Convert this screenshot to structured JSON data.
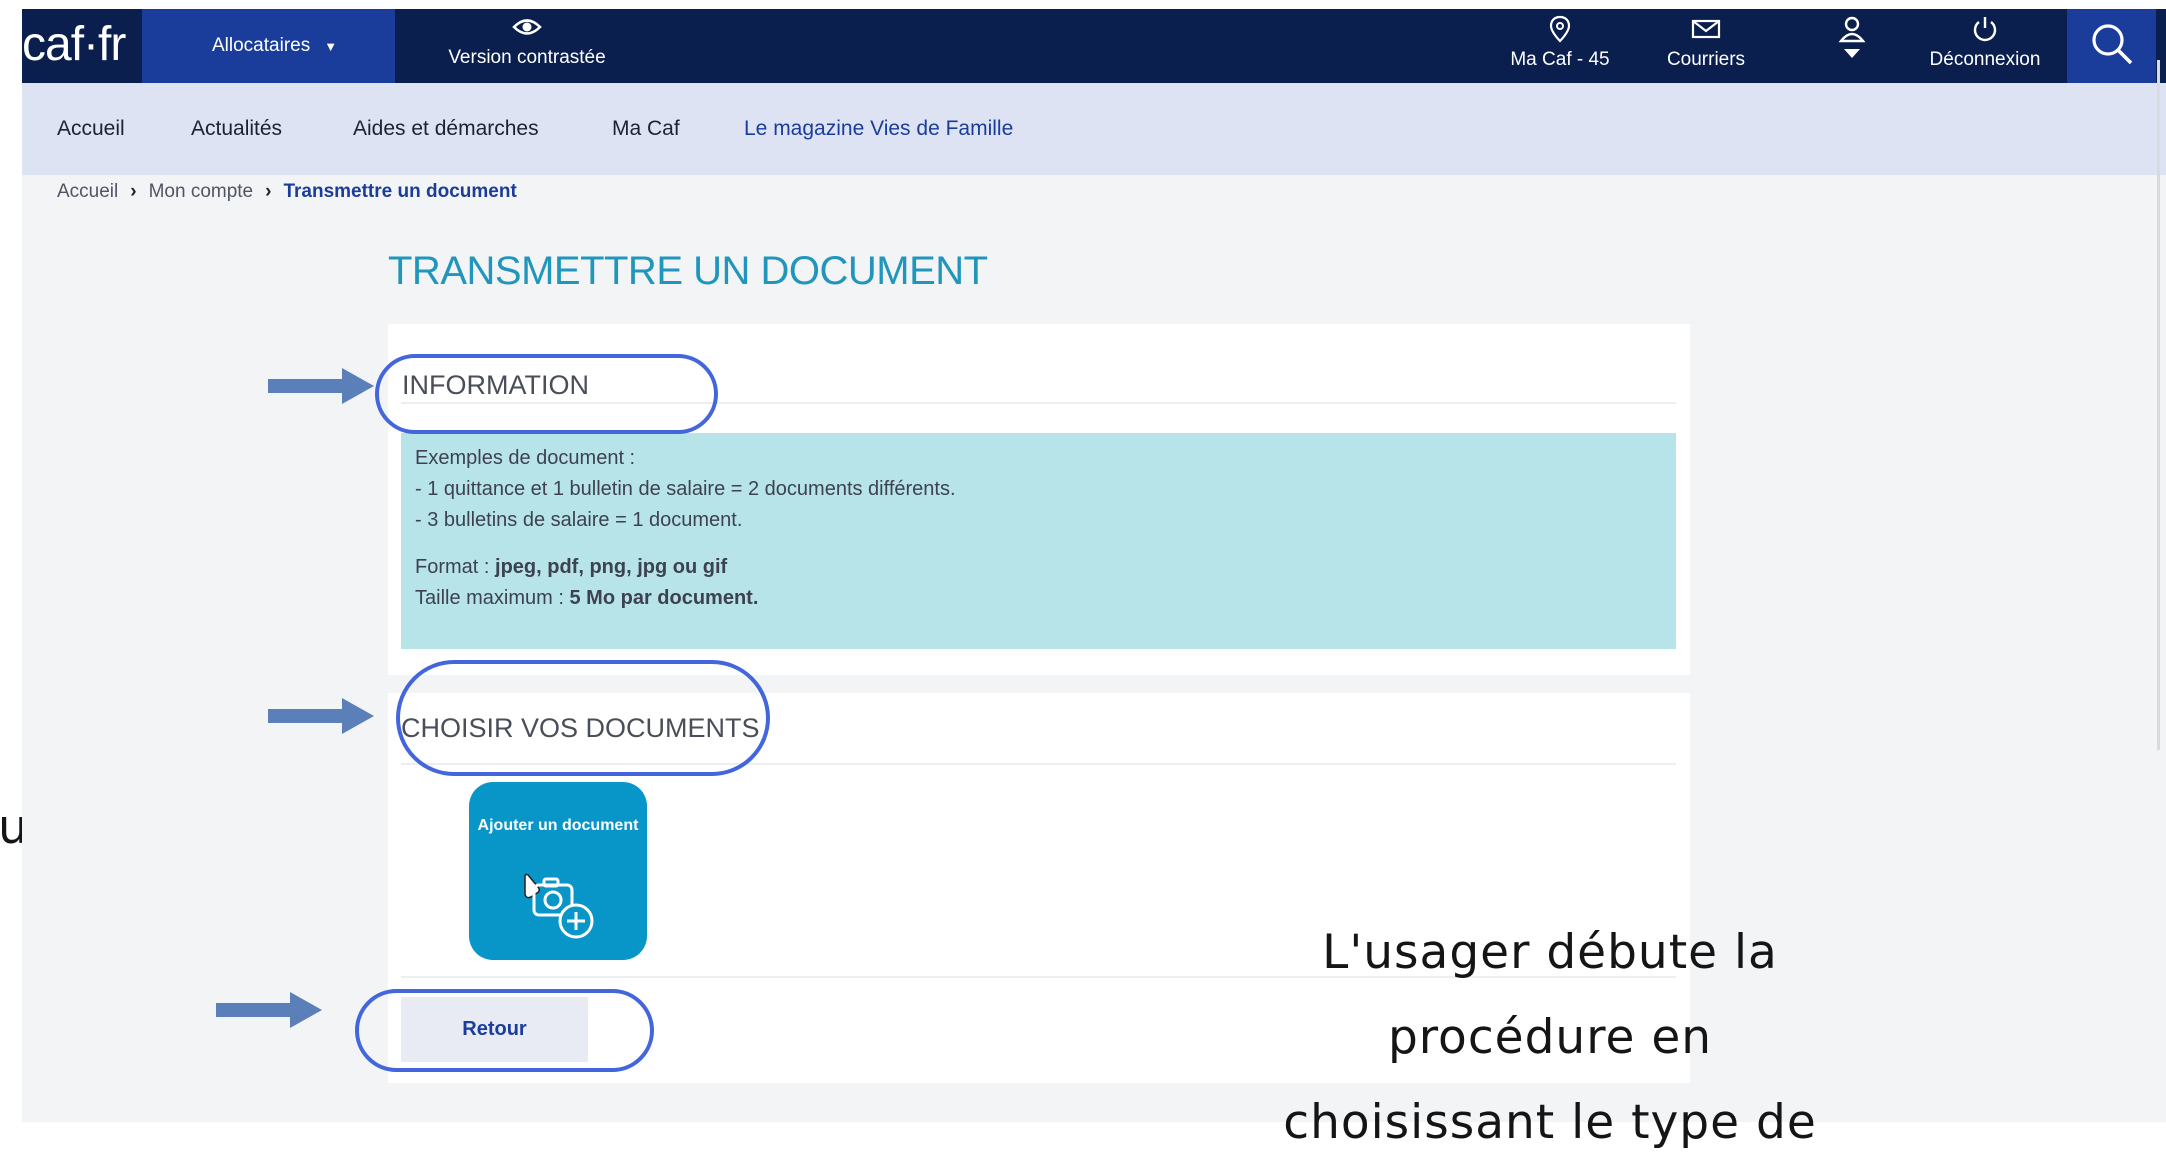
{
  "topbar": {
    "logo": "caf·fr",
    "audience": "Allocataires",
    "contrast": "Version contrastée",
    "macaf": "Ma Caf - 45",
    "courriers": "Courriers",
    "logout": "Déconnexion"
  },
  "nav": [
    "Accueil",
    "Actualités",
    "Aides et démarches",
    "Ma Caf",
    "Le magazine Vies de Famille"
  ],
  "breadcrumb": [
    "Accueil",
    "Mon compte",
    "Transmettre un document"
  ],
  "page": {
    "title": "TRANSMETTRE UN DOCUMENT",
    "info_heading": "INFORMATION",
    "info": {
      "intro": "Exemples de document :",
      "line1": "- 1 quittance et 1 bulletin de salaire = 2 documents différents.",
      "line2": "- 3 bulletins de salaire = 1 document.",
      "format_label": "Format : ",
      "format_value": "jpeg, pdf, png, jpg ou gif",
      "size_label": "Taille maximum : ",
      "size_value": "5 Mo par document."
    },
    "choose_heading": "CHOISIR VOS DOCUMENTS",
    "add_button": "Ajouter un document",
    "back_button": "Retour"
  },
  "slide": {
    "left_fragment": "ui",
    "caption": [
      "L'usager débute la",
      "procédure en",
      "choisissant le type de"
    ]
  },
  "colors": {
    "topbar": "#0b1f4f",
    "accent_blue": "#1a3d9c",
    "title_blue": "#2196bd",
    "info_box": "#b7e4e9",
    "add_tile": "#0896c8",
    "highlight_ring": "#4466dd",
    "arrow": "#5b7fb8"
  }
}
